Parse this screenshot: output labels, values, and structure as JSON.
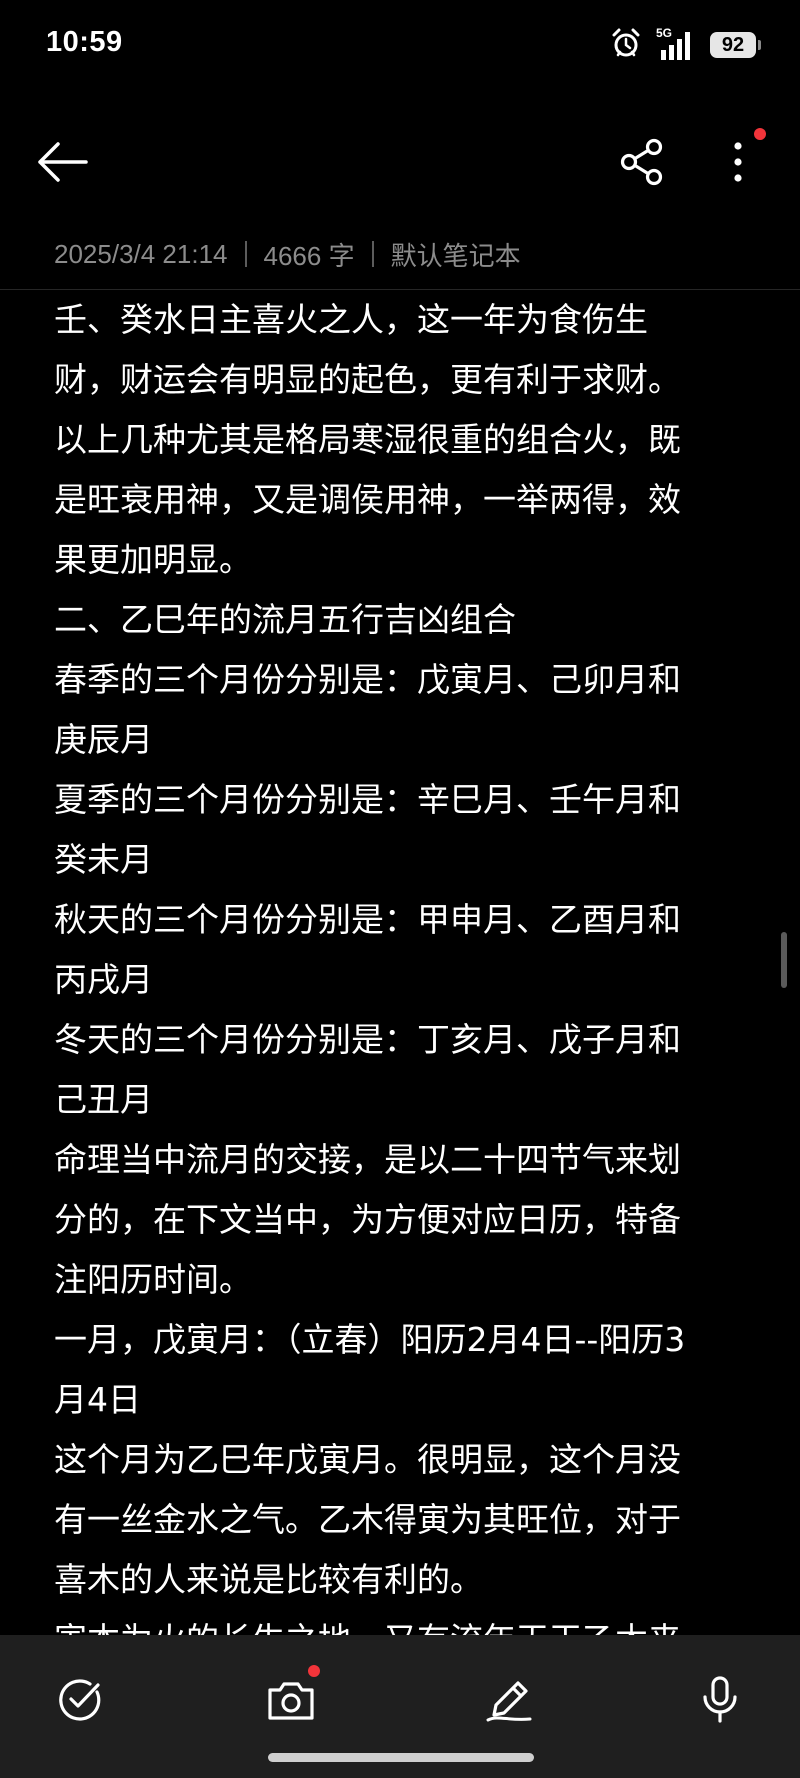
{
  "status_bar": {
    "time": "10:59",
    "network": "5G",
    "battery": "92",
    "icons": [
      "alarm-icon",
      "signal-icon",
      "battery-icon"
    ]
  },
  "toolbar": {
    "back_icon": "back-arrow-icon",
    "share_icon": "share-icon",
    "more_icon": "more-vertical-icon",
    "accent_dot_color": "#f2343a"
  },
  "meta": {
    "datetime": "2025/3/4 21:14",
    "word_count": "4666 字",
    "notebook": "默认笔记本"
  },
  "note": {
    "lines": [
      "壬、癸水日主喜火之人，这一年为食伤生",
      "财，财运会有明显的起色，更有利于求财。",
      "以上几种尤其是格局寒湿很重的组合火，既",
      "是旺衰用神，又是调侯用神，一举两得，效",
      "果更加明显。",
      "二、乙巳年的流月五行吉凶组合",
      "春季的三个月份分别是：戊寅月、己卯月和",
      "庚辰月",
      "夏季的三个月份分别是：辛巳月、壬午月和",
      "癸未月",
      "秋天的三个月份分别是：甲申月、乙酉月和",
      "丙戌月",
      "冬天的三个月份分别是：丁亥月、戊子月和",
      "己丑月",
      "命理当中流月的交接，是以二十四节气来划",
      "分的，在下文当中，为方便对应日历，特备",
      "注阳历时间。",
      "一月，戊寅月：（立春）阳历2月4日--阳历3",
      "月4日",
      "这个月为乙巳年戊寅月。很明显，这个月没",
      "有一丝金水之气。乙木得寅为其旺位，对于",
      "喜木的人来说是比较有利的。",
      "寅本为火的长生之地，又有流年天干乙木来"
    ]
  },
  "bottom_toolbar": {
    "items": [
      "checklist-icon",
      "camera-icon",
      "handwriting-pen-icon",
      "microphone-icon"
    ]
  }
}
